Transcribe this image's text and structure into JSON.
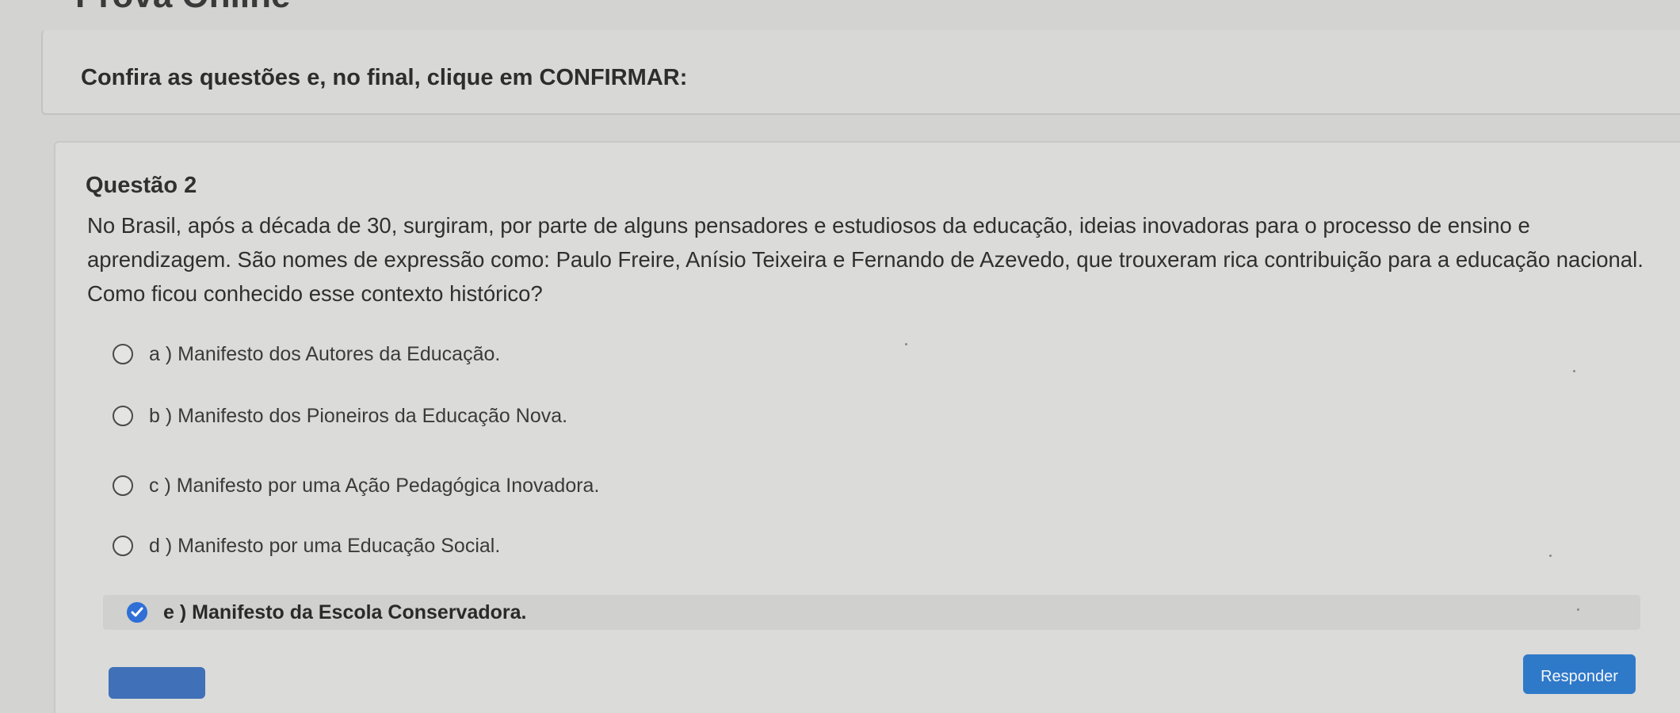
{
  "page": {
    "title": "Prova Online",
    "instructions": "Confira as questões e, no final, clique em CONFIRMAR:"
  },
  "question": {
    "title": "Questão 2",
    "text": "No Brasil, após a década de 30, surgiram, por parte de alguns pensadores e estudiosos da educação, ideias inovadoras para o processo de ensino e aprendizagem. São nomes de expressão como: Paulo Freire, Anísio Teixeira e Fernando de Azevedo, que trouxeram rica contribuição para a educação nacional. Como ficou conhecido esse contexto histórico?",
    "options": [
      {
        "label": "a ) Manifesto dos Autores da Educação.",
        "selected": false
      },
      {
        "label": "b ) Manifesto dos Pioneiros da Educação Nova.",
        "selected": false
      },
      {
        "label": "c ) Manifesto por uma Ação Pedagógica Inovadora.",
        "selected": false
      },
      {
        "label": "d ) Manifesto por uma Educação Social.",
        "selected": false
      },
      {
        "label": "e ) Manifesto da Escola Conservadora.",
        "selected": true
      }
    ]
  },
  "actions": {
    "respond_label": "Responder"
  },
  "colors": {
    "accent": "#2f79c9",
    "selected_radio": "#2f6fd6",
    "background": "#d3d3d2"
  }
}
